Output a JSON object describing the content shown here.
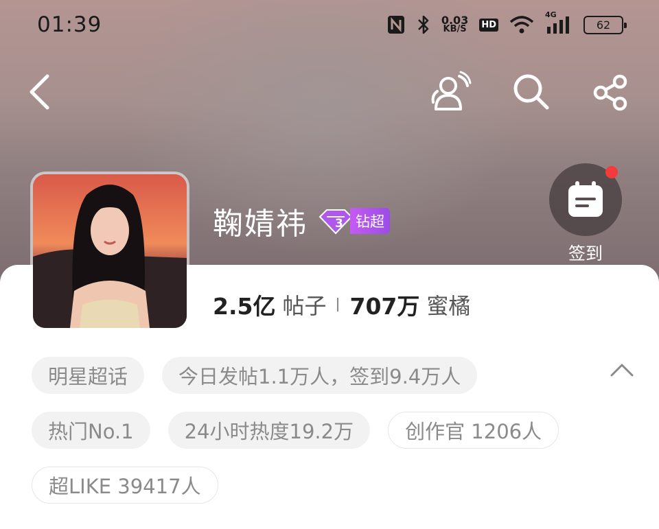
{
  "status_bar": {
    "time": "01:39",
    "net_speed_value": "0.03",
    "net_speed_unit": "KB/S",
    "hd_label": "HD",
    "signal_label": "4G",
    "battery_level": "62"
  },
  "header": {
    "icons": [
      "back-arrow-icon",
      "user-follow-icon",
      "search-icon",
      "share-icon"
    ]
  },
  "profile": {
    "name": "鞠婧祎",
    "badge_level": "3",
    "badge_label": "钻超",
    "posts_count": "2.5亿",
    "posts_label": "帖子",
    "fans_count": "707万",
    "fans_label": "蜜橘"
  },
  "checkin": {
    "label": "签到",
    "has_notification": true
  },
  "tags": {
    "row1": [
      "明星超话",
      "今日发帖1.1万人，签到9.4万人"
    ],
    "row2": [
      "热门No.1",
      "24小时热度19.2万",
      "创作官 1206人"
    ],
    "row3": [
      "超LIKE 39417人"
    ]
  },
  "colors": {
    "accent_purple": "#b057ee",
    "notification_red": "#f43a3a",
    "tag_text": "#8a8a8a"
  }
}
